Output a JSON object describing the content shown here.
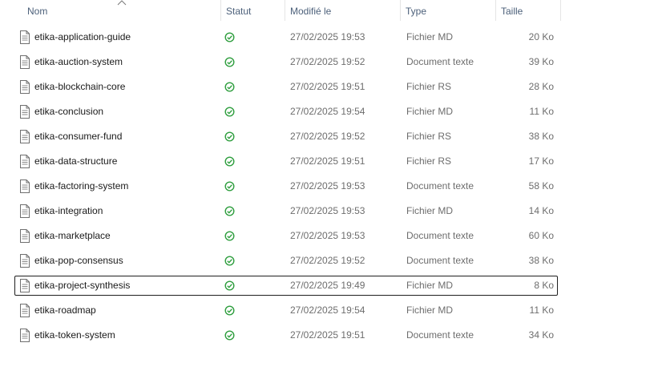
{
  "columns": {
    "name": "Nom",
    "status": "Statut",
    "modified": "Modifié le",
    "type": "Type",
    "size": "Taille"
  },
  "sort": {
    "column": "name",
    "direction": "ascending",
    "icon": "sort-up-chevron-icon"
  },
  "colors": {
    "header_text": "#4c607a",
    "status_ok": "#2e9e3e",
    "secondary_text": "#6d6d6d",
    "focus_border": "#1f1f1f"
  },
  "files": [
    {
      "name": "etika-application-guide",
      "status": "synced-icon",
      "modified": "27/02/2025 19:53",
      "type": "Fichier MD",
      "size": "20 Ko"
    },
    {
      "name": "etika-auction-system",
      "status": "synced-icon",
      "modified": "27/02/2025 19:52",
      "type": "Document texte",
      "size": "39 Ko"
    },
    {
      "name": "etika-blockchain-core",
      "status": "synced-icon",
      "modified": "27/02/2025 19:51",
      "type": "Fichier RS",
      "size": "28 Ko"
    },
    {
      "name": "etika-conclusion",
      "status": "synced-icon",
      "modified": "27/02/2025 19:54",
      "type": "Fichier MD",
      "size": "11 Ko"
    },
    {
      "name": "etika-consumer-fund",
      "status": "synced-icon",
      "modified": "27/02/2025 19:52",
      "type": "Fichier RS",
      "size": "38 Ko"
    },
    {
      "name": "etika-data-structure",
      "status": "synced-icon",
      "modified": "27/02/2025 19:51",
      "type": "Fichier RS",
      "size": "17 Ko"
    },
    {
      "name": "etika-factoring-system",
      "status": "synced-icon",
      "modified": "27/02/2025 19:53",
      "type": "Document texte",
      "size": "58 Ko"
    },
    {
      "name": "etika-integration",
      "status": "synced-icon",
      "modified": "27/02/2025 19:53",
      "type": "Fichier MD",
      "size": "14 Ko"
    },
    {
      "name": "etika-marketplace",
      "status": "synced-icon",
      "modified": "27/02/2025 19:53",
      "type": "Document texte",
      "size": "60 Ko"
    },
    {
      "name": "etika-pop-consensus",
      "status": "synced-icon",
      "modified": "27/02/2025 19:52",
      "type": "Document texte",
      "size": "38 Ko"
    },
    {
      "name": "etika-project-synthesis",
      "status": "synced-icon",
      "modified": "27/02/2025 19:49",
      "type": "Fichier MD",
      "size": "8 Ko",
      "focused": true
    },
    {
      "name": "etika-roadmap",
      "status": "synced-icon",
      "modified": "27/02/2025 19:54",
      "type": "Fichier MD",
      "size": "11 Ko"
    },
    {
      "name": "etika-token-system",
      "status": "synced-icon",
      "modified": "27/02/2025 19:51",
      "type": "Document texte",
      "size": "34 Ko"
    }
  ]
}
